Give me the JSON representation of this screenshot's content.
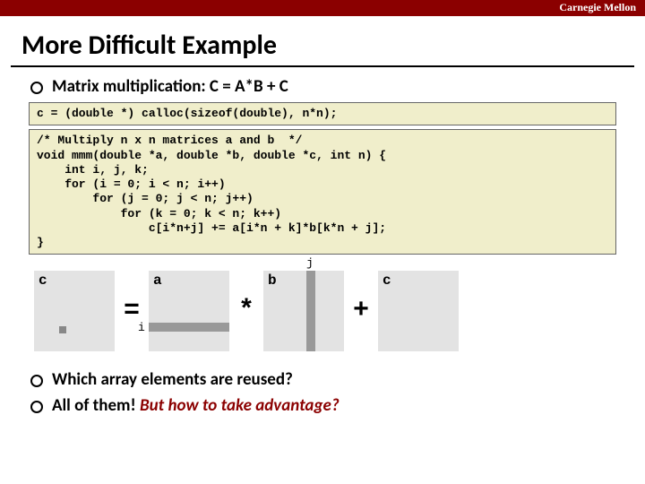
{
  "brand": "Carnegie Mellon",
  "title": "More Difficult Example",
  "bullet1": "Matrix multiplication: C = A*B + C",
  "code1": "c = (double *) calloc(sizeof(double), n*n);",
  "code2": "/* Multiply n x n matrices a and b  */\nvoid mmm(double *a, double *b, double *c, int n) {\n    int i, j, k;\n    for (i = 0; i < n; i++)\n        for (j = 0; j < n; j++)\n            for (k = 0; k < n; k++)\n                c[i*n+j] += a[i*n + k]*b[k*n + j];\n}",
  "mat": {
    "c1": "c",
    "a": "a",
    "b": "b",
    "c2": "c",
    "i": "i",
    "j": "j",
    "eq": "=",
    "star": "*",
    "plus": "+"
  },
  "bullet2": "Which array elements are reused?",
  "bullet3a": "All of them! ",
  "bullet3b": "But how to take advantage?"
}
